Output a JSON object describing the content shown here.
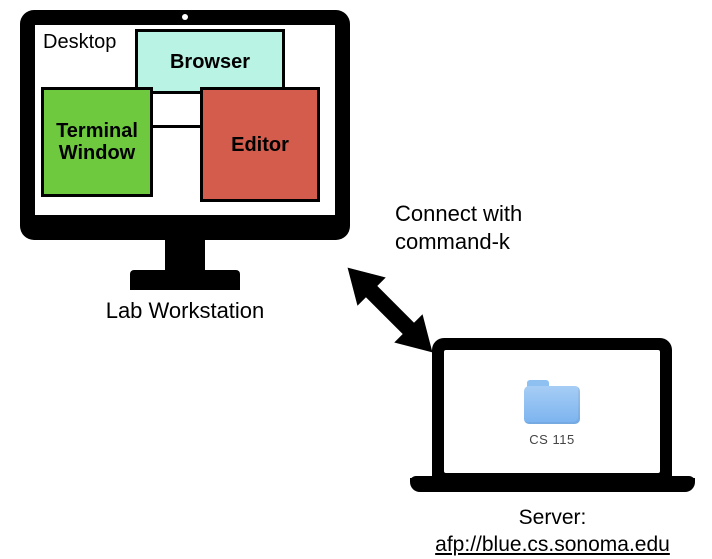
{
  "workstation": {
    "caption": "Lab Workstation",
    "desktop_label": "Desktop",
    "apps": {
      "browser": "Browser",
      "terminal": "Terminal\nWindow",
      "editor": "Editor"
    }
  },
  "connection": {
    "instruction": "Connect with\ncommand-k"
  },
  "server": {
    "folder_name": "CS 115",
    "caption_label": "Server:",
    "url": "afp://blue.cs.sonoma.edu"
  }
}
